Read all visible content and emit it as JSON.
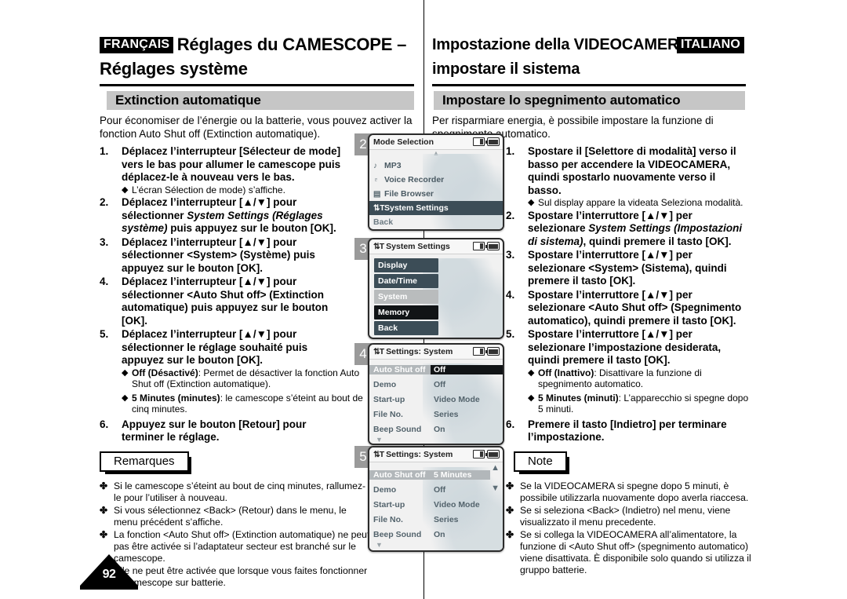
{
  "page": {
    "number": "92"
  },
  "header": {
    "left": {
      "lang_tag": "FRANÇAIS",
      "title_line1": "Réglages du CAMESCOPE –",
      "title_line2": "Réglages système",
      "section_bar": "Extinction automatique"
    },
    "right": {
      "lang_tag": "ITALIANO",
      "title_line1": "Impostazione della VIDEOCAMERA:",
      "title_line2": "impostare il sistema",
      "section_bar": "Impostare lo spegnimento automatico"
    }
  },
  "french": {
    "intro": "Pour économiser de l’énergie ou la batterie, vous pouvez activer la fonction Auto Shut off (Extinction automatique).",
    "steps": [
      {
        "num": "1.",
        "text": "Déplacez l’interrupteur [Sélecteur de mode] vers le bas pour allumer le camescope puis déplacez-le à nouveau vers le bas.",
        "subs": [
          {
            "bullet": "◆",
            "bold": "",
            "text": "L’écran Sélection de mode) s’affiche."
          }
        ]
      },
      {
        "num": "2.",
        "text_pre": "Déplacez l’interrupteur [▲/▼] pour sélectionner ",
        "text_italic": "System Settings (Réglages système)",
        "text_post": " puis appuyez sur le bouton [OK].",
        "subs": []
      },
      {
        "num": "3.",
        "text": "Déplacez l’interrupteur [▲/▼] pour sélectionner <System> (Système) puis appuyez sur le bouton [OK].",
        "subs": []
      },
      {
        "num": "4.",
        "text": "Déplacez l’interrupteur [▲/▼] pour sélectionner  <Auto Shut off> (Extinction automatique) puis appuyez sur le bouton [OK].",
        "subs": []
      },
      {
        "num": "5.",
        "text": "Déplacez l’interrupteur [▲/▼] pour sélectionner le réglage souhaité puis appuyez sur le bouton [OK].",
        "subs": [
          {
            "bullet": "◆",
            "bold": "Off (Désactivé)",
            "text": ": Permet de désactiver la fonction Auto Shut off (Extinction automatique)."
          },
          {
            "bullet": "◆",
            "bold": "5 Minutes (minutes)",
            "text": ": le camescope s’éteint au bout de cinq minutes."
          }
        ]
      },
      {
        "num": "6.",
        "text": "Appuyez sur le bouton [Retour] pour terminer le réglage.",
        "subs": []
      }
    ],
    "notes_title": "Remarques",
    "notes": [
      "Si le camescope s’éteint au bout de cinq minutes, rallumez-le pour l’utiliser à nouveau.",
      "Si vous sélectionnez <Back> (Retour) dans le menu, le menu précédent s’affiche.",
      "La fonction <Auto Shut off> (Extinction automatique) ne peut pas être activée si l’adaptateur secteur est branché sur le camescope.",
      "Elle ne peut être activée que lorsque vous faites fonctionner le camescope sur batterie."
    ],
    "note_bullet": "✤"
  },
  "italian": {
    "intro": "Per risparmiare energia, è possibile impostare la funzione di spegnimento automatico.",
    "steps": [
      {
        "num": "1.",
        "text": "Spostare il [Selettore di modalità] verso il basso per accendere la VIDEOCAMERA, quindi spostarlo nuovamente verso il basso.",
        "subs": [
          {
            "bullet": "◆",
            "bold": "",
            "text": "Sul display appare la videata Seleziona modalità."
          }
        ]
      },
      {
        "num": "2.",
        "text_pre": "Spostare l’interruttore [▲/▼] per selezionare ",
        "text_italic": "System Settings (Impostazioni di sistema)",
        "text_post": ", quindi premere il tasto [OK].",
        "subs": []
      },
      {
        "num": "3.",
        "text": "Spostare l’interruttore [▲/▼] per selezionare <System> (Sistema), quindi premere il tasto [OK].",
        "subs": []
      },
      {
        "num": "4.",
        "text": "Spostare l’interruttore [▲/▼] per selezionare <Auto Shut off> (Spegnimento automatico), quindi premere il tasto [OK].",
        "subs": []
      },
      {
        "num": "5.",
        "text": "Spostare l’interruttore [▲/▼] per selezionare l’impostazione desiderata, quindi premere il tasto [OK].",
        "subs": [
          {
            "bullet": "◆",
            "bold": "Off (Inattivo)",
            "text": ": Disattivare la funzione di spegnimento automatico."
          },
          {
            "bullet": "◆",
            "bold": "5 Minutes (minuti)",
            "text": ": L’apparecchio si spegne dopo 5 minuti."
          }
        ]
      },
      {
        "num": "6.",
        "text": "Premere il tasto [Indietro] per terminare l’impostazione.",
        "subs": []
      }
    ],
    "notes_title": "Note",
    "notes": [
      "Se la VIDEOCAMERA si spegne dopo 5 minuti, è possibile utilizzarla nuovamente dopo averla riaccesa.",
      "Se si seleziona <Back> (Indietro) nel menu, viene visualizzato il menu precedente.",
      "Se si collega la VIDEOCAMERA all’alimentatore, la funzione di <Auto Shut off> (spegnimento automatico) viene disattivata. È disponibile solo quando si utilizza il gruppo batterie."
    ],
    "note_bullet": "✤"
  },
  "screens": [
    {
      "badge": "2",
      "title": "Mode Selection",
      "title_icon": "",
      "rows": [
        {
          "icon": "♪",
          "label": "MP3",
          "state": "normal"
        },
        {
          "icon": "♇",
          "label": "Voice Recorder",
          "state": "normal"
        },
        {
          "icon": "▤",
          "label": "File Browser",
          "state": "normal"
        },
        {
          "icon": "⇅T",
          "label": "System Settings",
          "state": "selected"
        },
        {
          "icon": "",
          "label": "Back",
          "state": "plain"
        }
      ],
      "arrow_up": "▲",
      "arrow_down": ""
    },
    {
      "badge": "3",
      "title": "System Settings",
      "title_icon": "⇅T",
      "buttons": [
        {
          "label": "Display",
          "state": "normal"
        },
        {
          "label": "Date/Time",
          "state": "normal"
        },
        {
          "label": "System",
          "state": "highlight"
        },
        {
          "label": "Memory",
          "state": "dark"
        },
        {
          "label": "Back",
          "state": "normal"
        }
      ]
    },
    {
      "badge": "4",
      "title": "Settings: System",
      "title_icon": "⇅T",
      "settings": [
        {
          "label": "Auto Shut off",
          "value": "Off",
          "label_state": "highlight",
          "value_state": "dark"
        },
        {
          "label": "Demo",
          "value": "Off",
          "label_state": "normal",
          "value_state": "normal"
        },
        {
          "label": "Start-up",
          "value": "Video Mode",
          "label_state": "normal",
          "value_state": "normal"
        },
        {
          "label": "File No.",
          "value": "Series",
          "label_state": "normal",
          "value_state": "normal"
        },
        {
          "label": "Beep Sound",
          "value": "On",
          "label_state": "normal",
          "value_state": "normal"
        }
      ],
      "arrow_down": "▼"
    },
    {
      "badge": "5",
      "title": "Settings: System",
      "title_icon": "⇅T",
      "settings": [
        {
          "label": "Auto Shut off",
          "value": "5 Minutes",
          "label_state": "highlight",
          "value_state": "highlight"
        },
        {
          "label": "Demo",
          "value": "Off",
          "label_state": "normal",
          "value_state": "normal"
        },
        {
          "label": "Start-up",
          "value": "Video Mode",
          "label_state": "normal",
          "value_state": "normal"
        },
        {
          "label": "File No.",
          "value": "Series",
          "label_state": "normal",
          "value_state": "normal"
        },
        {
          "label": "Beep Sound",
          "value": "On",
          "label_state": "normal",
          "value_state": "normal"
        }
      ],
      "arrow_up": "▲",
      "arrow_down": "▼"
    }
  ],
  "colors": {
    "section_bar": "#c6c6c6",
    "lcd_selected": "#3c4d57",
    "lcd_highlight": "#b2b7ba",
    "lcd_dark": "#111416",
    "badge": "#9a9a9a"
  }
}
